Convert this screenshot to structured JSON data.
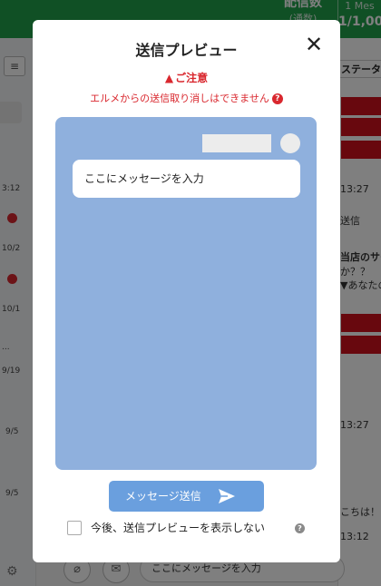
{
  "header": {
    "delivery_count_label": "配信数",
    "delivery_count_sub": "(通数)",
    "quota_top": "1 Mes",
    "quota_value": "1/1,00"
  },
  "left_column": {
    "timestamps": [
      "3:12",
      "10/2",
      "10/1",
      "...",
      "9/19",
      "9/5",
      "9/5"
    ]
  },
  "right_column": {
    "status_label": "ステータス",
    "time_1": "13:27",
    "text_1": "送信",
    "text_2": "当店のサー",
    "text_3": "か？？",
    "text_4": "▼あなたの",
    "time_2": "13:27",
    "text_5": "こちは！",
    "time_3": "13:12"
  },
  "composer": {
    "input_text": "ここにメッセージを入力"
  },
  "modal": {
    "title": "送信プレビュー",
    "warning_title": "ご注意",
    "warning_note": "エルメからの送信取り消しはできません",
    "preview_message": "ここにメッセージを入力",
    "send_label": "メッセージ送信",
    "checkbox_label": "今後、送信プレビューを表示しない",
    "checkbox_checked": false
  },
  "colors": {
    "brand_green": "#21a04b",
    "warning_red": "#d9272e",
    "preview_bg": "#8fb0dd",
    "send_button": "#6a9fde"
  }
}
